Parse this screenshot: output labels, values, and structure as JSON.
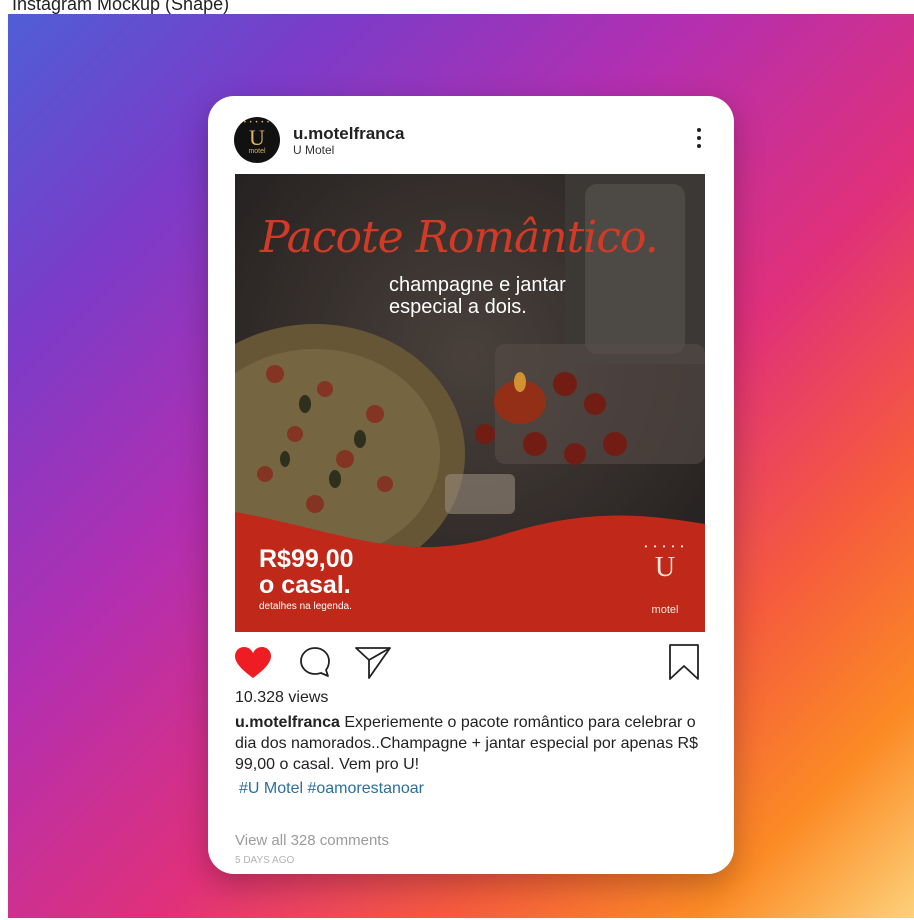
{
  "page": {
    "caption_fragment": "Instagram Mockup (Shape)"
  },
  "post": {
    "username": "u.motelfranca",
    "account_name": "U Motel",
    "avatar": {
      "mark": "U",
      "sub": "motel",
      "dots": "• • • • •"
    },
    "image": {
      "script_title": "Pacote Romântico.",
      "tagline_line1": "champagne e jantar",
      "tagline_line2": "especial a dois.",
      "price_line1": "R$99,00",
      "price_line2": "o casal.",
      "price_note": "detalhes na legenda.",
      "logo_mark": "U",
      "logo_dots": "• • • • •",
      "logo_text": "motel"
    },
    "views": "10.328 views",
    "caption_handle": "u.motelfranca",
    "caption_body": " Experiemente o pacote romântico para celebrar o dia dos namorados..Champagne + jantar especial por apenas R$ 99,00 o casal. Vem pro U!",
    "hashtags": "#U Motel #oamorestanoar",
    "comments_link": "View all 328 comments",
    "timestamp": "5 DAYS AGO"
  },
  "colors": {
    "like_active": "#ee1d24",
    "hashtag": "#2a6fa0",
    "brand_red": "#c0291a"
  },
  "icons": [
    "heart-icon",
    "comment-icon",
    "share-icon",
    "bookmark-icon",
    "more-options-icon"
  ]
}
